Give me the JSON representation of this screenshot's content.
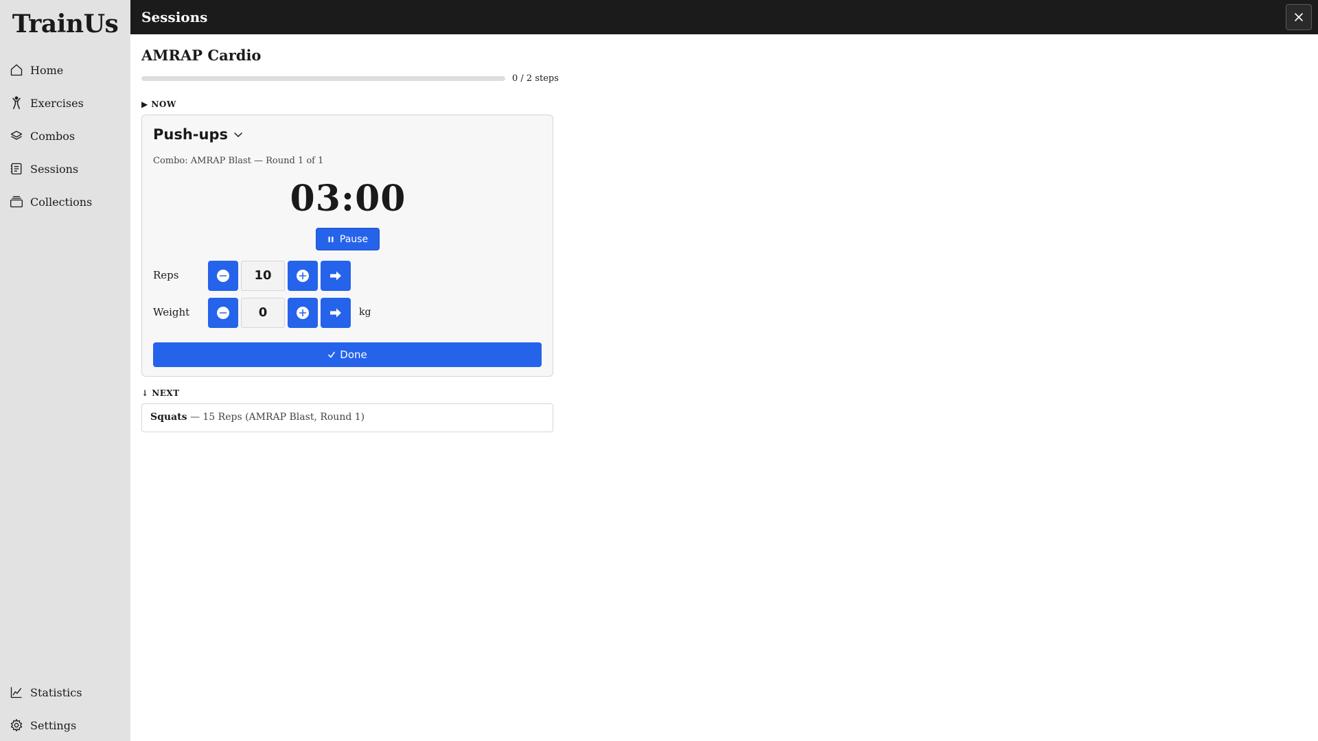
{
  "app": {
    "brand": "TrainUs"
  },
  "sidebar": {
    "top_items": [
      {
        "label": "Home",
        "icon": "home-icon"
      },
      {
        "label": "Exercises",
        "icon": "person-icon"
      },
      {
        "label": "Combos",
        "icon": "layers-icon"
      },
      {
        "label": "Sessions",
        "icon": "list-icon"
      },
      {
        "label": "Collections",
        "icon": "stack-icon"
      }
    ],
    "bottom_items": [
      {
        "label": "Statistics",
        "icon": "chart-icon"
      },
      {
        "label": "Settings",
        "icon": "gear-icon"
      }
    ]
  },
  "topbar": {
    "title": "Sessions",
    "close_icon": "close-icon"
  },
  "session": {
    "title": "AMRAP Cardio",
    "progress": {
      "current": 0,
      "total": 2,
      "text": "0 / 2 steps"
    }
  },
  "now": {
    "label": "▶ NOW",
    "exercise": "Push-ups",
    "combo_info": "Combo: AMRAP Blast — Round 1 of 1",
    "timer": "03:00",
    "pause_label": "Pause",
    "reps": {
      "label": "Reps",
      "value": "10"
    },
    "weight": {
      "label": "Weight",
      "value": "0",
      "unit": "kg"
    },
    "done_label": "Done"
  },
  "next": {
    "label": "↓ NEXT",
    "exercise": "Squats",
    "detail": " — 15 Reps (AMRAP Blast, Round 1)"
  },
  "colors": {
    "accent": "#2563eb",
    "topbar": "#1b1b1b",
    "sidebar": "#e2e2e2"
  }
}
